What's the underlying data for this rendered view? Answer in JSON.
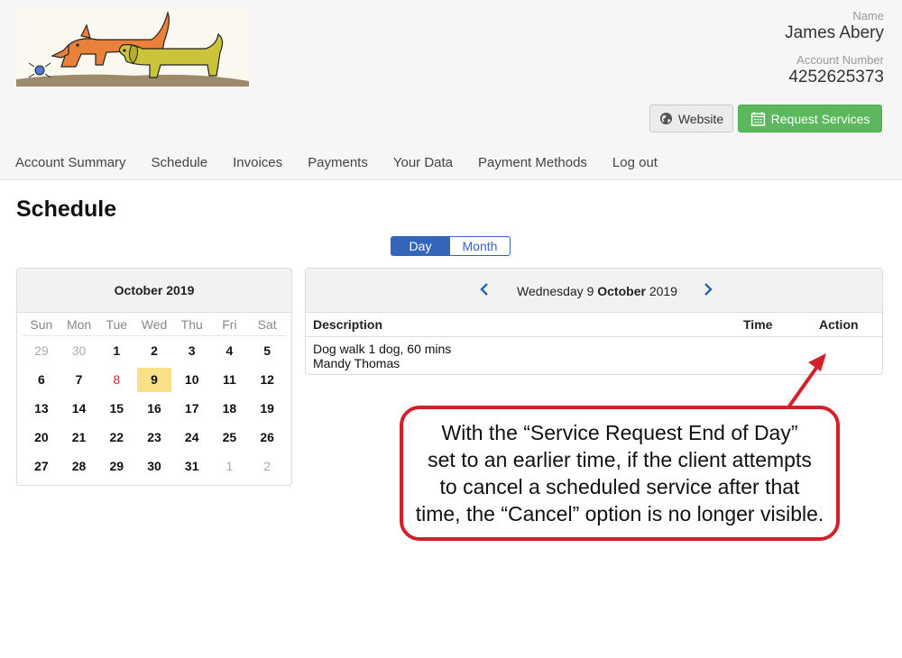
{
  "account": {
    "name_label": "Name",
    "name": "James Abery",
    "number_label": "Account Number",
    "number": "4252625373"
  },
  "buttons": {
    "website": "Website",
    "request": "Request Services"
  },
  "nav": [
    "Account Summary",
    "Schedule",
    "Invoices",
    "Payments",
    "Your Data",
    "Payment Methods",
    "Log out"
  ],
  "page_title": "Schedule",
  "view_toggle": {
    "day": "Day",
    "month": "Month",
    "selected": "Day"
  },
  "calendar": {
    "title": "October 2019",
    "weekdays": [
      "Sun",
      "Mon",
      "Tue",
      "Wed",
      "Thu",
      "Fri",
      "Sat"
    ],
    "weeks": [
      [
        "29",
        "30",
        "1",
        "2",
        "3",
        "4",
        "5"
      ],
      [
        "6",
        "7",
        "8",
        "9",
        "10",
        "11",
        "12"
      ],
      [
        "13",
        "14",
        "15",
        "16",
        "17",
        "18",
        "19"
      ],
      [
        "20",
        "21",
        "22",
        "23",
        "24",
        "25",
        "26"
      ],
      [
        "27",
        "28",
        "29",
        "30",
        "31",
        "1",
        "2"
      ]
    ],
    "today": "8",
    "selected": "9"
  },
  "schedule": {
    "date_prefix": "Wednesday 9 ",
    "date_month": "October",
    "date_year": " 2019",
    "columns": {
      "description": "Description",
      "time": "Time",
      "action": "Action"
    },
    "rows": [
      {
        "line1": "Dog walk 1 dog, 60 mins",
        "line2": "Mandy Thomas",
        "time": "",
        "action": ""
      }
    ]
  },
  "callout": {
    "lines": [
      "With the “Service Request End of Day”",
      "set to an earlier time, if the client attempts",
      "to cancel a scheduled service after that",
      "time, the “Cancel” option is no longer visible."
    ]
  },
  "colors": {
    "primary": "#3366bb",
    "success": "#5cb85c",
    "callout_border": "#d4202a",
    "highlight": "#fbe08a"
  },
  "icons": {
    "website": "globe-icon",
    "request": "calendar-icon",
    "prev": "chevron-left-icon",
    "next": "chevron-right-icon"
  }
}
